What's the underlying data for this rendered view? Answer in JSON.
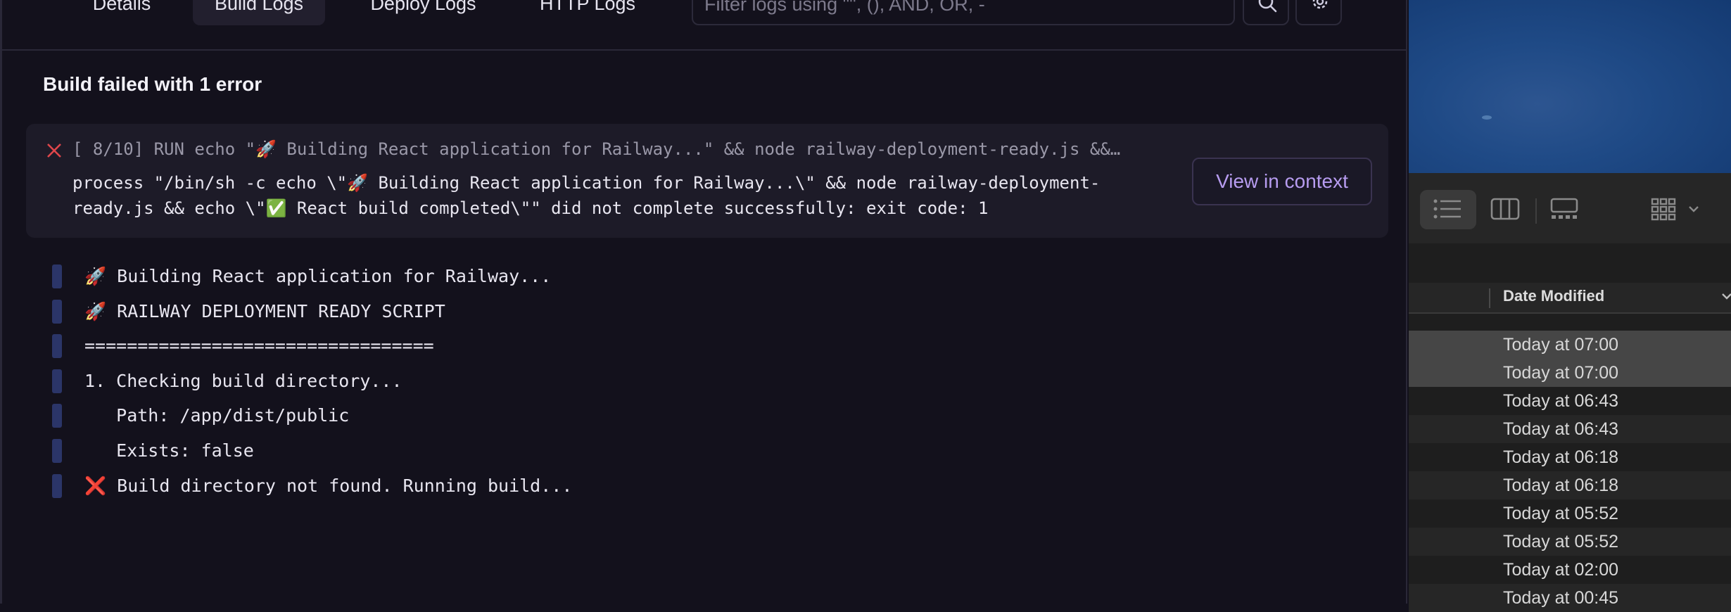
{
  "tabs": [
    {
      "label": "Details",
      "active": false
    },
    {
      "label": "Build Logs",
      "active": true
    },
    {
      "label": "Deploy Logs",
      "active": false
    },
    {
      "label": "HTTP Logs",
      "active": false
    }
  ],
  "filter": {
    "placeholder": "Filter logs using \"\", (), AND, OR, -",
    "value": ""
  },
  "icons": {
    "search": "search-icon",
    "settings": "gear-icon",
    "error": "close-x-icon"
  },
  "build": {
    "title": "Build failed with 1 error",
    "error": {
      "summary": "[ 8/10] RUN echo \"🚀 Building React application for Railway...\" && node railway-deployment-ready.js &&…",
      "detail": "process \"/bin/sh -c echo \\\"🚀 Building React application for Railway...\\\" && node railway-deployment-ready.js && echo \\\"✅ React build completed\\\"\" did not complete successfully: exit code: 1",
      "button": "View in context"
    },
    "log_lines": [
      "🚀 Building React application for Railway...",
      "🚀 RAILWAY DEPLOYMENT READY SCRIPT",
      "=================================",
      "1. Checking build directory...",
      "   Path: /app/dist/public",
      "   Exists: false",
      "❌ Build directory not found. Running build..."
    ]
  },
  "colors": {
    "accent": "#b79cf0",
    "error": "#e0464b",
    "log_marker": "#2b3568",
    "bg": "#13111c"
  },
  "finder": {
    "column_header": "Date Modified",
    "view_icons": [
      "list-view-icon",
      "column-view-icon",
      "gallery-view-icon",
      "group-by-icon"
    ],
    "dates": [
      "Today at 07:00",
      "Today at 07:00",
      "Today at 06:43",
      "Today at 06:43",
      "Today at 06:18",
      "Today at 06:18",
      "Today at 05:52",
      "Today at 05:52",
      "Today at 02:00",
      "Today at 00:45"
    ],
    "selected_rows": [
      0,
      1
    ]
  }
}
